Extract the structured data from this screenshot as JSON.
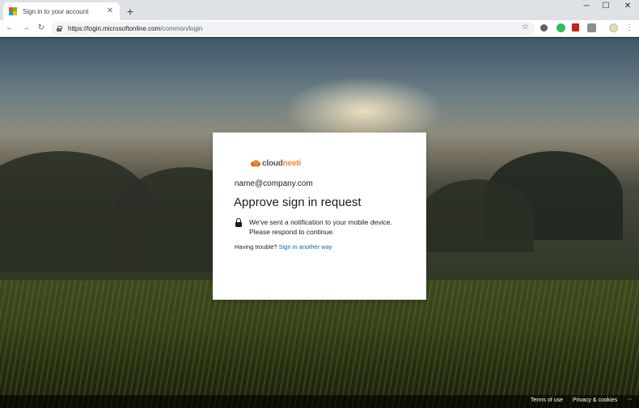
{
  "browser": {
    "tab_title": "Sign in to your account",
    "tab_close_icon": "close-icon",
    "new_tab_label": "+",
    "window_controls": {
      "minimize": "─",
      "maximize": "☐",
      "close": "✕"
    },
    "nav": {
      "back": "←",
      "forward": "→",
      "reload": "↻"
    },
    "url_host": "https://login.microsoftonline.com",
    "url_path": "/common/login",
    "bookmark_star": "☆",
    "menu_dots": "⋮",
    "favicon_colors": [
      "#f25022",
      "#7fba00",
      "#00a4ef",
      "#ffb900"
    ]
  },
  "card": {
    "logo_main": "cloud",
    "logo_accent": "neeti",
    "email": "name@company.com",
    "heading": "Approve sign in request",
    "notice_line1": "We've sent a notification to your mobile device.",
    "notice_line2": "Please respond to continue.",
    "trouble_prefix": "Having trouble?",
    "trouble_link": "Sign in another way"
  },
  "footer": {
    "terms": "Terms of use",
    "privacy": "Privacy & cookies",
    "more": "···"
  },
  "colors": {
    "link": "#0067b8",
    "logo_orange": "#f0882e",
    "card_bg": "#ffffff"
  }
}
